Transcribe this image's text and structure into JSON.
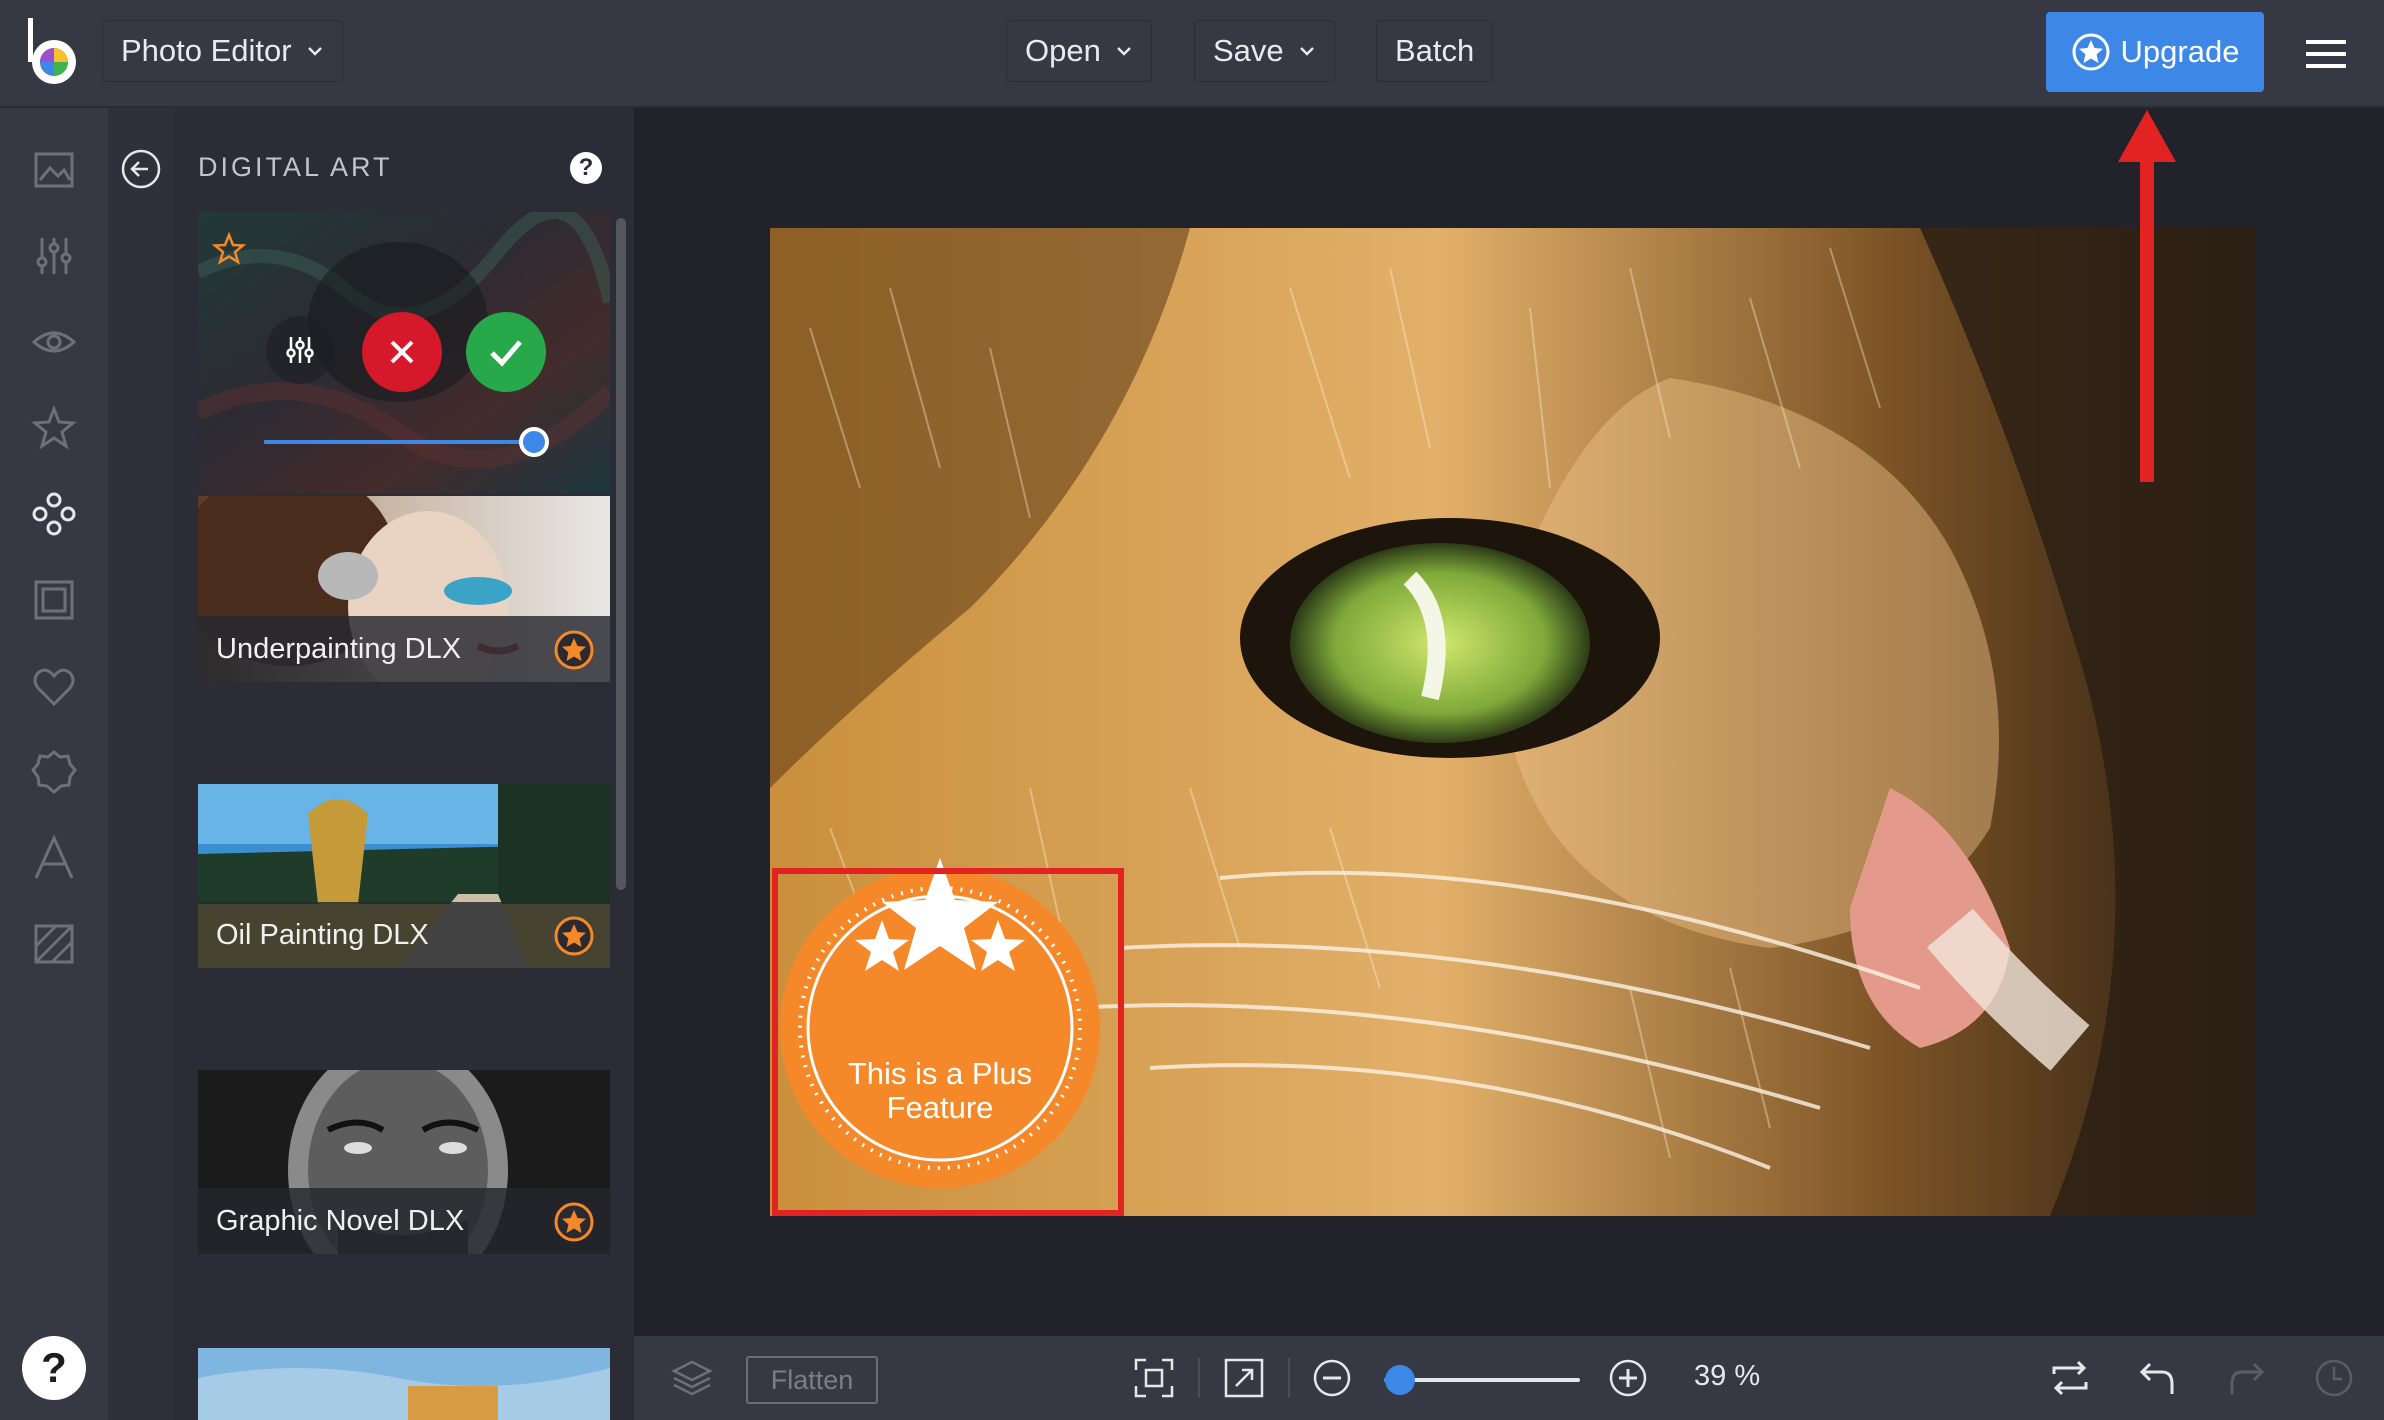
{
  "topbar": {
    "app_menu_label": "Photo Editor",
    "open_label": "Open",
    "save_label": "Save",
    "batch_label": "Batch",
    "upgrade_label": "Upgrade",
    "brand_color": "#3d87e6"
  },
  "rail": {
    "items": [
      "image-icon",
      "adjust-sliders-icon",
      "eye-icon",
      "star-icon",
      "effects-icon",
      "frame-icon",
      "heart-icon",
      "badge-icon",
      "text-icon",
      "texture-icon"
    ],
    "active": "effects-icon",
    "help_label": "?"
  },
  "panel": {
    "title": "DIGITAL ART",
    "help_label": "?",
    "active_filter": {
      "intensity": 1.0,
      "controls": [
        "adjust-icon",
        "cancel-icon",
        "apply-icon"
      ]
    },
    "filters": [
      {
        "label": "Underpainting DLX",
        "plus": true
      },
      {
        "label": "Oil Painting DLX",
        "plus": true
      },
      {
        "label": "Graphic Novel DLX",
        "plus": true
      }
    ]
  },
  "canvas": {
    "plus_badge_line1": "This is a Plus",
    "plus_badge_line2": "Feature",
    "badge_color": "#f5892a",
    "highlight_color": "#e32222"
  },
  "bottombar": {
    "flatten_label": "Flatten",
    "zoom": 0.39,
    "zoom_label": "39 %"
  }
}
